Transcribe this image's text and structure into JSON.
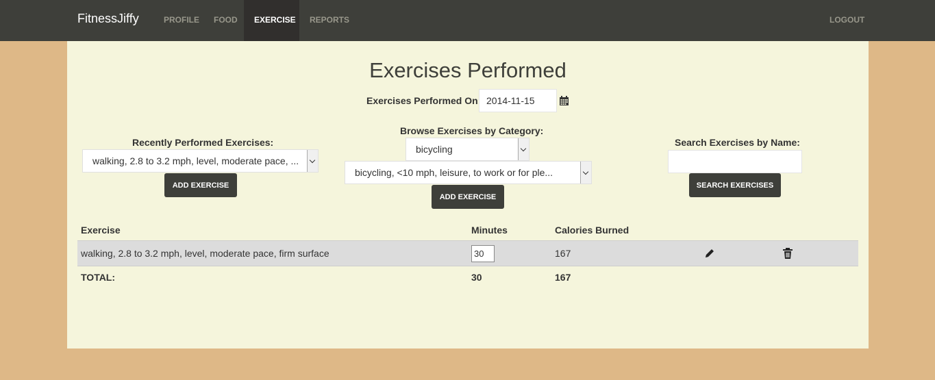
{
  "navbar": {
    "brand": "FitnessJiffy",
    "items": [
      {
        "label": "PROFILE"
      },
      {
        "label": "FOOD"
      },
      {
        "label": "EXERCISE",
        "active": true
      },
      {
        "label": "REPORTS"
      }
    ],
    "logout": "LOGOUT"
  },
  "page": {
    "title": "Exercises Performed",
    "date_label": "Exercises Performed On:",
    "date_value": "2014-11-15"
  },
  "recent": {
    "label": "Recently Performed Exercises:",
    "selected": "walking, 2.8 to 3.2 mph, level, moderate pace, ...",
    "button": "ADD EXERCISE"
  },
  "browse": {
    "label": "Browse Exercises by Category:",
    "category_selected": "bicycling",
    "exercise_selected": "bicycling, <10 mph, leisure, to work or for ple...",
    "button": "ADD EXERCISE"
  },
  "search": {
    "label": "Search Exercises by Name:",
    "value": "",
    "button": "SEARCH EXERCISES"
  },
  "table": {
    "headers": {
      "exercise": "Exercise",
      "minutes": "Minutes",
      "calories": "Calories Burned"
    },
    "rows": [
      {
        "exercise": "walking, 2.8 to 3.2 mph, level, moderate pace, firm surface",
        "minutes": "30",
        "calories": "167"
      }
    ],
    "total": {
      "label": "TOTAL:",
      "minutes": "30",
      "calories": "167"
    }
  },
  "icons": {
    "calendar": "calendar-icon",
    "edit": "pencil-icon",
    "delete": "trash-icon"
  },
  "colors": {
    "navbar": "#3e3f3a",
    "background": "#deb887",
    "content": "#f5f5dc",
    "button": "#3e3f3a"
  }
}
